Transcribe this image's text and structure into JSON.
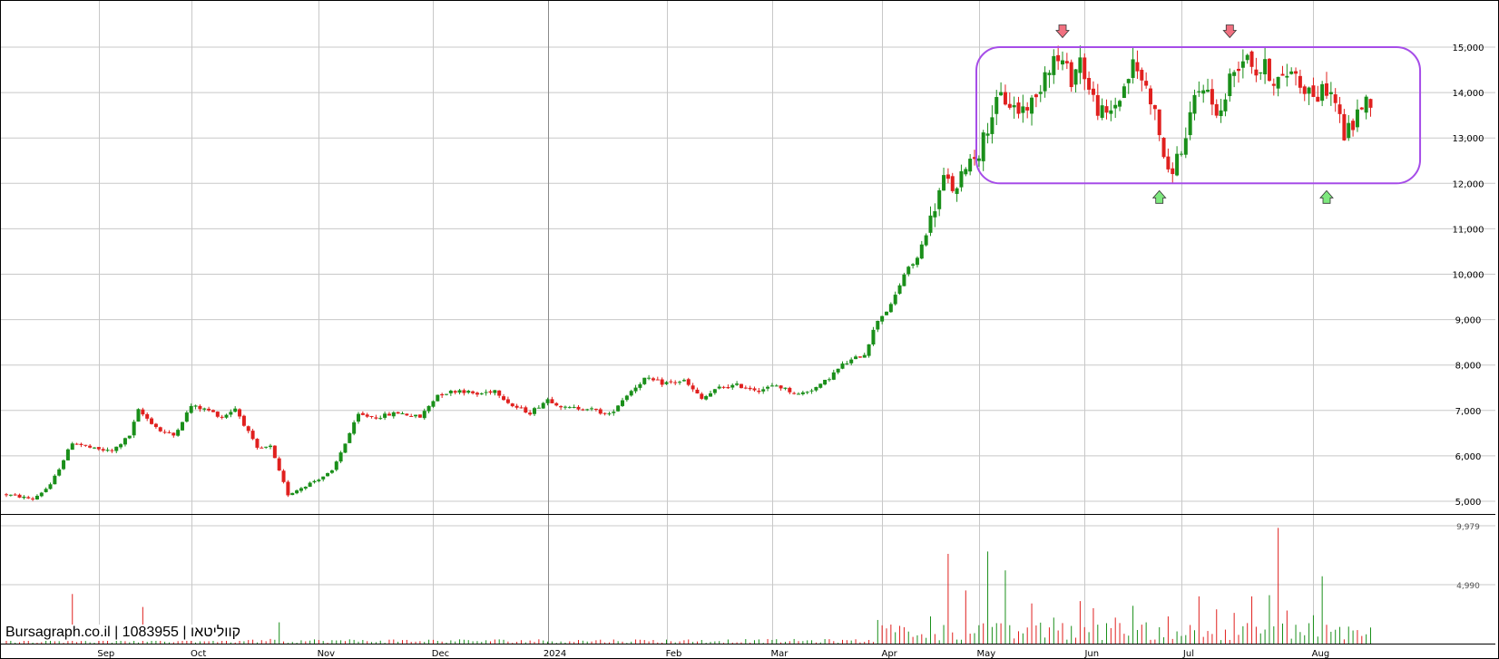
{
  "watermark": "Bursagraph.co.il | 1083955 | קווליטאו",
  "chart_data": [
    {
      "type": "candlestick",
      "name": "price",
      "y_ticks": [
        "5,000",
        "6,000",
        "7,000",
        "8,000",
        "9,000",
        "10,000",
        "11,000",
        "12,000",
        "13,000",
        "14,000",
        "15,000"
      ],
      "ylim": [
        4780,
        15900
      ],
      "x_tick_labels": [
        {
          "label": "Sep",
          "day": 21
        },
        {
          "label": "Oct",
          "day": 42
        },
        {
          "label": "Nov",
          "day": 71
        },
        {
          "label": "Dec",
          "day": 97
        },
        {
          "label": "2024",
          "day": 123
        },
        {
          "label": "Feb",
          "day": 150
        },
        {
          "label": "Mar",
          "day": 174
        },
        {
          "label": "Apr",
          "day": 199
        },
        {
          "label": "May",
          "day": 221
        },
        {
          "label": "Jun",
          "day": 245
        },
        {
          "label": "Jul",
          "day": 267
        },
        {
          "label": "Aug",
          "day": 297
        }
      ],
      "x_range_days": [
        0,
        328
      ],
      "grid": true,
      "up_color": "#1a8f1a",
      "down_color": "#e0201e",
      "anchors": [
        [
          0,
          5150
        ],
        [
          6,
          5050
        ],
        [
          10,
          5350
        ],
        [
          15,
          6300
        ],
        [
          20,
          6150
        ],
        [
          24,
          6100
        ],
        [
          28,
          6450
        ],
        [
          30,
          7000
        ],
        [
          35,
          6550
        ],
        [
          38,
          6450
        ],
        [
          42,
          7100
        ],
        [
          46,
          7000
        ],
        [
          49,
          6850
        ],
        [
          52,
          7050
        ],
        [
          54,
          6700
        ],
        [
          57,
          6150
        ],
        [
          60,
          6200
        ],
        [
          62,
          5650
        ],
        [
          64,
          5150
        ],
        [
          66,
          5250
        ],
        [
          70,
          5450
        ],
        [
          74,
          5650
        ],
        [
          78,
          6500
        ],
        [
          80,
          6900
        ],
        [
          84,
          6850
        ],
        [
          89,
          6950
        ],
        [
          94,
          6850
        ],
        [
          98,
          7350
        ],
        [
          103,
          7450
        ],
        [
          107,
          7350
        ],
        [
          111,
          7450
        ],
        [
          115,
          7100
        ],
        [
          119,
          6950
        ],
        [
          123,
          7250
        ],
        [
          127,
          7050
        ],
        [
          132,
          7050
        ],
        [
          137,
          6900
        ],
        [
          141,
          7350
        ],
        [
          145,
          7700
        ],
        [
          149,
          7600
        ],
        [
          154,
          7650
        ],
        [
          158,
          7250
        ],
        [
          162,
          7500
        ],
        [
          166,
          7550
        ],
        [
          171,
          7450
        ],
        [
          175,
          7550
        ],
        [
          180,
          7350
        ],
        [
          185,
          7550
        ],
        [
          190,
          8000
        ],
        [
          195,
          8250
        ],
        [
          198,
          9000
        ],
        [
          201,
          9300
        ],
        [
          204,
          10000
        ],
        [
          207,
          10350
        ],
        [
          210,
          11200
        ],
        [
          213,
          12100
        ],
        [
          216,
          11800
        ],
        [
          218,
          12450
        ],
        [
          221,
          12700
        ],
        [
          224,
          13550
        ],
        [
          226,
          13900
        ],
        [
          230,
          13600
        ],
        [
          234,
          13850
        ],
        [
          236,
          14500
        ],
        [
          238,
          14750
        ],
        [
          240,
          14650
        ],
        [
          242,
          14300
        ],
        [
          244,
          14750
        ],
        [
          246,
          14050
        ],
        [
          248,
          13650
        ],
        [
          250,
          13450
        ],
        [
          253,
          13900
        ],
        [
          256,
          14600
        ],
        [
          258,
          14300
        ],
        [
          260,
          13900
        ],
        [
          262,
          13100
        ],
        [
          264,
          12150
        ],
        [
          266,
          12550
        ],
        [
          268,
          12950
        ],
        [
          270,
          13850
        ],
        [
          272,
          14200
        ],
        [
          274,
          13750
        ],
        [
          276,
          13550
        ],
        [
          278,
          14300
        ],
        [
          280,
          14650
        ],
        [
          282,
          14900
        ],
        [
          284,
          14450
        ],
        [
          286,
          14550
        ],
        [
          288,
          14300
        ],
        [
          290,
          14250
        ],
        [
          292,
          14550
        ],
        [
          294,
          14200
        ],
        [
          296,
          14050
        ],
        [
          298,
          13900
        ],
        [
          300,
          14100
        ],
        [
          302,
          13800
        ],
        [
          304,
          13050
        ],
        [
          306,
          13300
        ],
        [
          308,
          13750
        ],
        [
          310,
          13850
        ]
      ]
    },
    {
      "type": "bar",
      "name": "volume",
      "y_ticks": [
        "4,990",
        "9,979"
      ],
      "ylim": [
        0,
        9979
      ],
      "spikes": [
        [
          15,
          4200
        ],
        [
          31,
          3100
        ],
        [
          62,
          1800
        ],
        [
          198,
          2000
        ],
        [
          210,
          2300
        ],
        [
          214,
          7600
        ],
        [
          218,
          4500
        ],
        [
          223,
          7800
        ],
        [
          227,
          6200
        ],
        [
          233,
          3400
        ],
        [
          238,
          2200
        ],
        [
          244,
          3600
        ],
        [
          247,
          3000
        ],
        [
          252,
          2200
        ],
        [
          256,
          3200
        ],
        [
          264,
          2300
        ],
        [
          271,
          4000
        ],
        [
          275,
          2900
        ],
        [
          279,
          2600
        ],
        [
          283,
          4000
        ],
        [
          287,
          4100
        ],
        [
          289,
          9800
        ],
        [
          291,
          2800
        ],
        [
          297,
          2400
        ],
        [
          299,
          5700
        ]
      ]
    }
  ],
  "annotations": {
    "range_box": {
      "from_day": 220,
      "to_day": 313,
      "price_high": 15000,
      "price_low": 12000,
      "color": "#a64de8"
    },
    "arrows_down": [
      {
        "day": 240,
        "price": 15350
      },
      {
        "day": 278,
        "price": 15350
      }
    ],
    "arrows_up": [
      {
        "day": 262,
        "price": 11700
      },
      {
        "day": 300,
        "price": 11700
      }
    ]
  }
}
